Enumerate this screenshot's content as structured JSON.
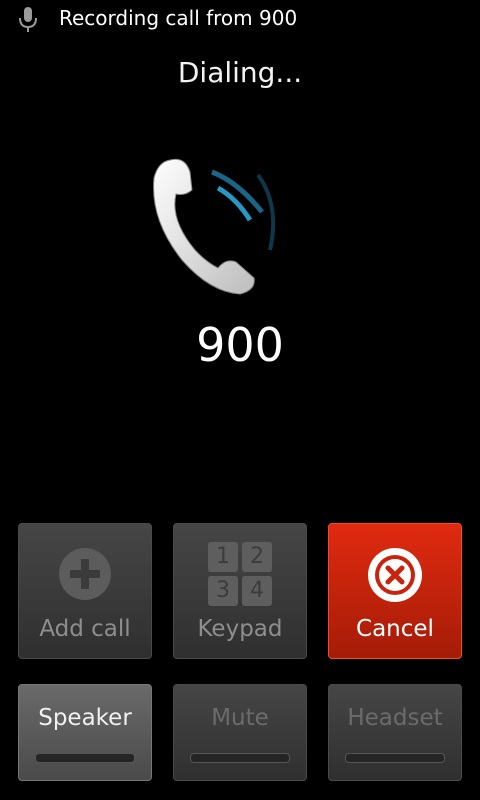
{
  "notification": {
    "icon": "microphone-icon",
    "text": "Recording call from 900"
  },
  "call": {
    "state": "Dialing...",
    "number": "900",
    "graphic": "phone-handset-icon"
  },
  "actions": {
    "add_call": "Add call",
    "keypad": "Keypad",
    "keypad_digits": [
      "1",
      "2",
      "3",
      "4"
    ],
    "cancel": "Cancel",
    "speaker": "Speaker",
    "mute": "Mute",
    "headset": "Headset"
  },
  "colors": {
    "cancel": "#c9230d",
    "accent_glow": "#2aa9d8"
  }
}
